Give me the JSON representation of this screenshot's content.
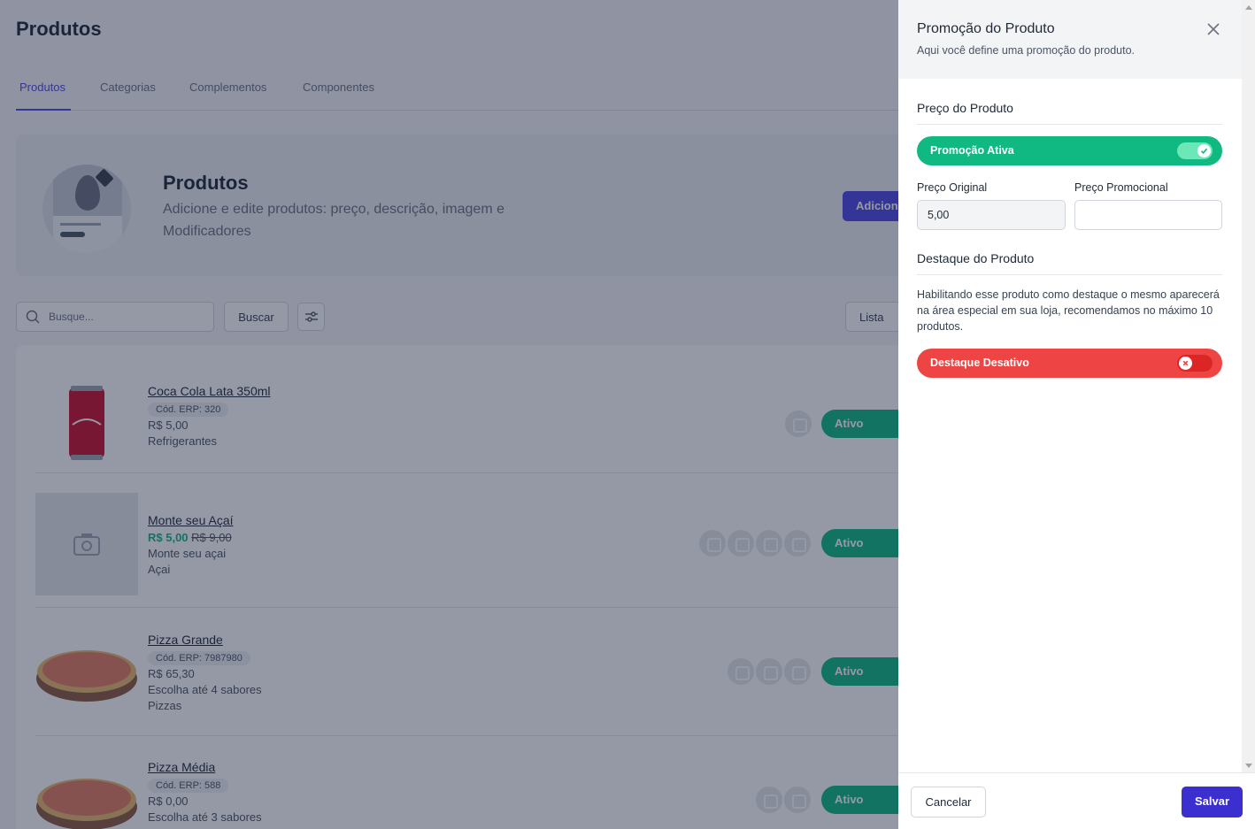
{
  "page": {
    "title": "Produtos",
    "tabs": [
      {
        "label": "Produtos",
        "active": true
      },
      {
        "label": "Categorias",
        "active": false
      },
      {
        "label": "Complementos",
        "active": false
      },
      {
        "label": "Componentes",
        "active": false
      }
    ],
    "hero": {
      "title": "Produtos",
      "description": "Adicione e edite produtos: preço, descrição, imagem e Modificadores",
      "add_button": "Adiciona"
    },
    "toolbar": {
      "search_placeholder": "Busque...",
      "search_button": "Buscar",
      "view_button": "Lista"
    },
    "products": [
      {
        "name": "Coca Cola Lata 350ml",
        "code": "Cód. ERP: 320",
        "price": "R$ 5,00",
        "line1": "Refrigerantes",
        "line2": "",
        "status": "Ativo"
      },
      {
        "name": "Monte seu Açaí",
        "promo_price": "R$ 5,00",
        "old_price": "R$ 9,00",
        "line1": "Monte seu açai",
        "line2": "Açai",
        "status": "Ativo"
      },
      {
        "name": "Pizza Grande",
        "code": "Cód. ERP: 7987980",
        "price": "R$ 65,30",
        "line1": "Escolha até 4 sabores",
        "line2": "Pizzas",
        "status": "Ativo"
      },
      {
        "name": "Pizza Média",
        "code": "Cód. ERP: 588",
        "price": "R$ 0,00",
        "line1": "Escolha até 3 sabores",
        "line2": "",
        "status": "Ativo"
      }
    ]
  },
  "modal": {
    "title": "Promoção do Produto",
    "subtitle": "Aqui você define uma promoção do produto.",
    "price_section": {
      "title": "Preço do Produto",
      "toggle_label": "Promoção Ativa",
      "toggle_on": true,
      "original_label": "Preço Original",
      "original_value": "5,00",
      "promo_label": "Preço Promocional",
      "promo_value": ""
    },
    "highlight_section": {
      "title": "Destaque do Produto",
      "help": "Habilitando esse produto como destaque o mesmo aparecerá na área especial em sua loja, recomendamos no máximo 10 produtos.",
      "toggle_label": "Destaque Desativo",
      "toggle_on": false
    },
    "footer": {
      "cancel": "Cancelar",
      "save": "Salvar"
    }
  },
  "colors": {
    "accent": "#4f46e5",
    "save": "#3b2fcf",
    "active_green": "#10b981",
    "inactive_red": "#ef4444"
  },
  "icons": [
    "close-icon",
    "search-icon",
    "filter-icon",
    "check-icon",
    "x-icon",
    "camera-icon"
  ]
}
